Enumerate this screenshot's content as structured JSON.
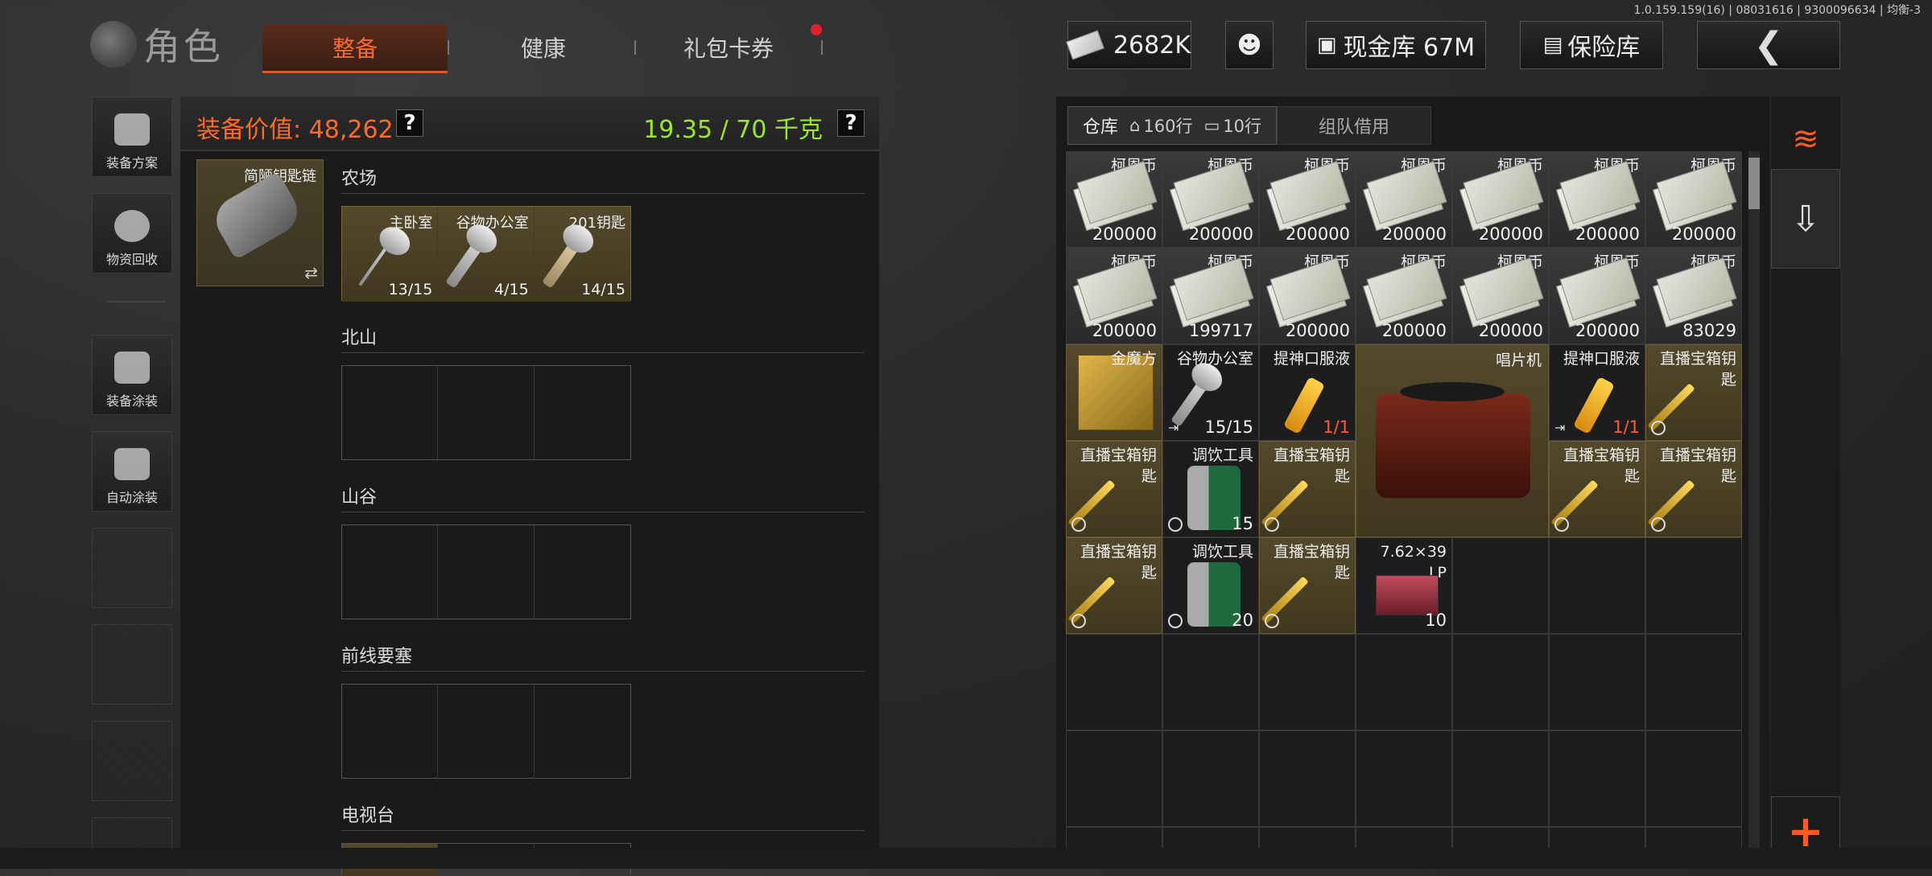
{
  "build_info": "1.0.159.159(16) | 08031616 | 9300096634 | 均衡-3",
  "header": {
    "title": "角色",
    "tabs": [
      "整备",
      "健康",
      "礼包卡券"
    ],
    "money": "2682K",
    "cash_vault": "现金库 67M",
    "insurance": "保险库",
    "back": "❮"
  },
  "sidebar": {
    "items": [
      {
        "label": "装备方案"
      },
      {
        "label": "物资回收"
      },
      {
        "label": "装备涂装"
      },
      {
        "label": "自动涂装"
      }
    ]
  },
  "equipment": {
    "value_text": "装备价值: 48,262",
    "weight_text": "19.35 / 70 千克",
    "help": "?",
    "keychain": {
      "name": "简陋钥匙链",
      "swap": "⇄"
    },
    "areas": [
      {
        "title": "农场",
        "keys": [
          {
            "name": "主卧室",
            "count": "13/15"
          },
          {
            "name": "谷物办公室",
            "count": "4/15"
          },
          {
            "name": "201钥匙",
            "count": "14/15"
          }
        ]
      },
      {
        "title": "北山"
      },
      {
        "title": "山谷"
      },
      {
        "title": "前线要塞"
      },
      {
        "title": "电视台"
      }
    ]
  },
  "warehouse": {
    "tab_label": "仓库",
    "rows_label": "160行",
    "extra_rows_label": "10行",
    "team_tab": "组队借用",
    "money_name": "柯恩币",
    "money_counts": [
      "200000",
      "200000",
      "200000",
      "200000",
      "200000",
      "200000",
      "200000",
      "200000",
      "199717",
      "200000",
      "200000",
      "200000",
      "200000",
      "83029"
    ],
    "items": {
      "cube": {
        "name": "金魔方"
      },
      "grain_key": {
        "name": "谷物办公室",
        "count": "15/15"
      },
      "stim1": {
        "name": "提神口服液",
        "count": "1/1"
      },
      "gramophone": {
        "name": "唱片机"
      },
      "stim2": {
        "name": "提神口服液",
        "count": "1/1"
      },
      "stream_key": {
        "name": "直播宝箱钥匙"
      },
      "drink_tool_1": {
        "name": "调饮工具",
        "count": "15"
      },
      "drink_tool_2": {
        "name": "调饮工具",
        "count": "20"
      },
      "ammo": {
        "name": "7.62×39\nLP",
        "count": "10"
      }
    }
  },
  "rail": {
    "sort": "≋",
    "import": "⇩",
    "add": "+"
  }
}
